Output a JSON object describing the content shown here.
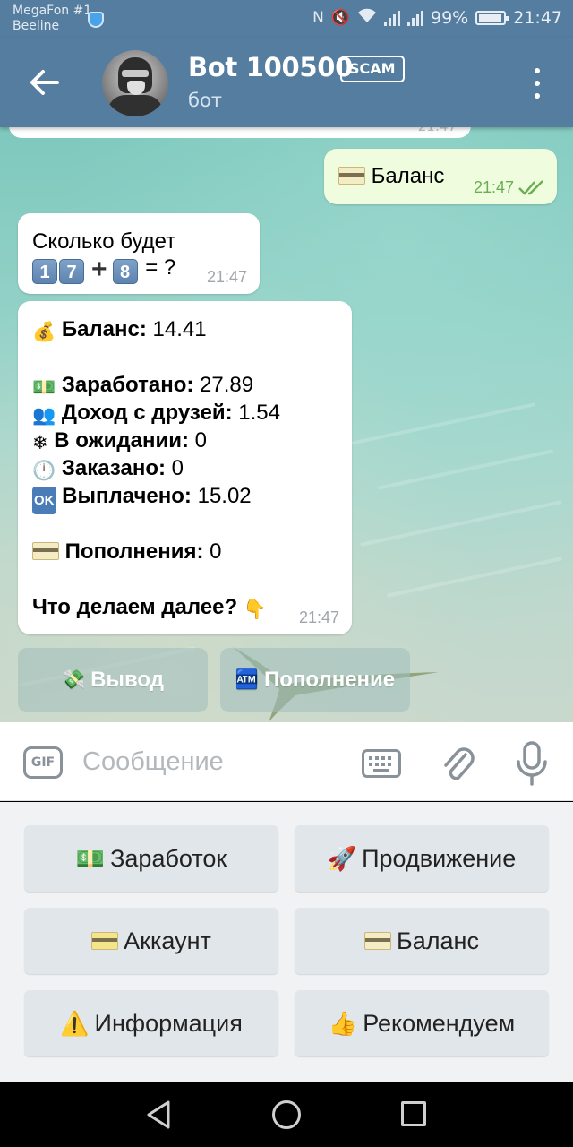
{
  "status_bar": {
    "carrier_1": "MegaFon #1",
    "carrier_2": "Beeline",
    "battery": "99%",
    "time": "21:47"
  },
  "header": {
    "title": "Bot 100500",
    "badge": "SCAM",
    "subtitle": "бот"
  },
  "messages": {
    "previous_time": "21:47",
    "outgoing": {
      "text": "Баланс",
      "time": "21:47"
    },
    "question": {
      "line1": "Сколько будет",
      "eq": "= ?",
      "digits": [
        "1",
        "7",
        "8"
      ],
      "time": "21:47"
    },
    "stats": {
      "balance_label": "Баланс:",
      "balance_value": " 14.41",
      "earned_label": "Заработано:",
      "earned_value": " 27.89",
      "friends_label": "Доход с друзей:",
      "friends_value": " 1.54",
      "pending_label": "В ожидании:",
      "pending_value": " 0",
      "ordered_label": "Заказано:",
      "ordered_value": " 0",
      "paid_label": "Выплачено:",
      "paid_value": " 15.02",
      "topups_label": "Пополнения:",
      "topups_value": " 0",
      "next": "Что делаем далее?",
      "time": "21:47"
    }
  },
  "inline_keyboard": {
    "withdraw": "Вывод",
    "topup": "Пополнение"
  },
  "input": {
    "placeholder": "Сообщение",
    "gif": "GIF"
  },
  "reply_keyboard": {
    "earnings": "Заработок",
    "promotion": "Продвижение",
    "account": "Аккаунт",
    "balance": "Баланс",
    "info": "Информация",
    "recommend": "Рекомендуем"
  },
  "icons": {
    "ok_badge": "OK"
  },
  "colors": {
    "header": "#557da0",
    "outgoing_bubble": "#effdde",
    "keyboard_button": "#e1e6ea"
  }
}
